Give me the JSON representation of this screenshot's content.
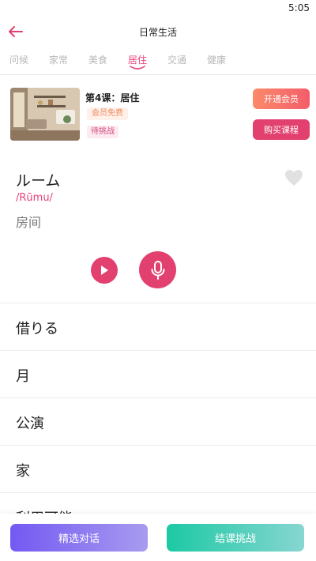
{
  "status": {
    "time": "5:05"
  },
  "header": {
    "title": "日常生活",
    "back_icon": "arrow-left-icon"
  },
  "tabs": [
    {
      "label": "问候",
      "active": false
    },
    {
      "label": "家常",
      "active": false
    },
    {
      "label": "美食",
      "active": false
    },
    {
      "label": "居住",
      "active": true
    },
    {
      "label": "交通",
      "active": false
    },
    {
      "label": "健康",
      "active": false
    }
  ],
  "lesson": {
    "title": "第4课：居住",
    "tag_free": "会员免费",
    "tag_pending": "待挑战",
    "btn_member": "开通会员",
    "btn_buy": "购买课程"
  },
  "current_word": {
    "word": "ルーム",
    "romaji": "/Rūmu/",
    "meaning": "房间",
    "favorite_icon": "heart-icon"
  },
  "audio_controls": {
    "play_icon": "play-icon",
    "mic_icon": "microphone-icon"
  },
  "word_list": [
    "借りる",
    "月",
    "公演",
    "家",
    "利用可能"
  ],
  "bottom": {
    "dialog_label": "精选对话",
    "challenge_label": "结课挑战"
  },
  "colors": {
    "accent": "#e2416f",
    "dialog_gradient": [
      "#7459f2",
      "#a79bef"
    ],
    "challenge_gradient": [
      "#1cc9a4",
      "#87d6d1"
    ]
  }
}
